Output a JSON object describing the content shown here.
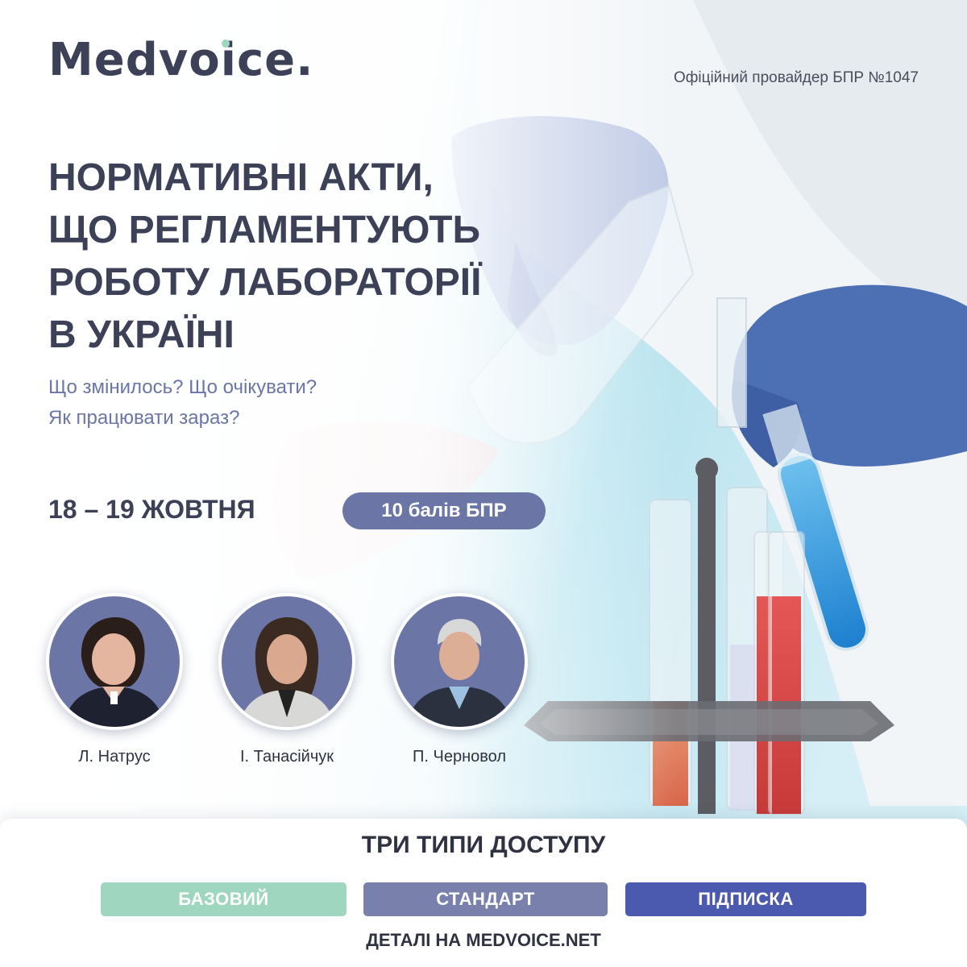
{
  "brand": {
    "logo_text": "Medvoice",
    "logo_dot": "."
  },
  "provider": "Офіційний провайдер БПР №1047",
  "title_lines": [
    "НОРМАТИВНІ АКТИ,",
    "ЩО РЕГЛАМЕНТУЮТЬ",
    "РОБОТУ ЛАБОРАТОРІЇ",
    "В УКРАЇНІ"
  ],
  "subtitle_lines": [
    "Що змінилось? Що очікувати?",
    "Як працювати зараз?"
  ],
  "dates": "18 – 19 ЖОВТНЯ",
  "credit_badge": "10 балів БПР",
  "speakers": [
    {
      "name": "Л. Натрус"
    },
    {
      "name": "І. Танасійчук"
    },
    {
      "name": "П. Черновол"
    }
  ],
  "access": {
    "title": "ТРИ ТИПИ ДОСТУПУ",
    "tiers": [
      {
        "label": "БАЗОВИЙ",
        "color": "#9fd6c0"
      },
      {
        "label": "СТАНДАРТ",
        "color": "#7880ab"
      },
      {
        "label": "ПІДПИСКА",
        "color": "#4b5aae"
      }
    ],
    "details": "ДЕТАЛІ НА MEDVOICE.NET"
  },
  "colors": {
    "primary_dark": "#3d4158",
    "accent": "#6b76a6",
    "mint": "#9fd6c0"
  }
}
